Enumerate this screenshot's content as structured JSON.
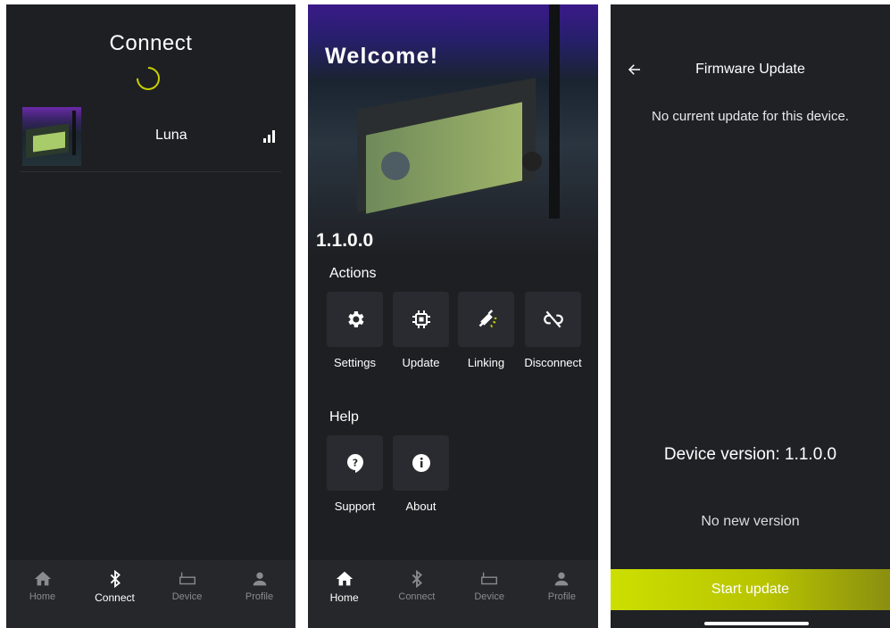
{
  "connect_screen": {
    "title": "Connect",
    "device": {
      "name": "Luna",
      "signal_icon": "signal-bars-icon"
    },
    "tabs": [
      {
        "label": "Home",
        "icon": "home-icon",
        "active": false
      },
      {
        "label": "Connect",
        "icon": "bluetooth-icon",
        "active": true
      },
      {
        "label": "Device",
        "icon": "device-icon",
        "active": false
      },
      {
        "label": "Profile",
        "icon": "profile-icon",
        "active": false
      }
    ]
  },
  "home_screen": {
    "welcome": "Welcome!",
    "version": "1.1.0.0",
    "actions_heading": "Actions",
    "actions": [
      {
        "label": "Settings",
        "icon": "gear-icon"
      },
      {
        "label": "Update",
        "icon": "chip-icon"
      },
      {
        "label": "Linking",
        "icon": "plug-link-icon"
      },
      {
        "label": "Disconnect",
        "icon": "unlink-icon"
      }
    ],
    "help_heading": "Help",
    "help": [
      {
        "label": "Support",
        "icon": "help-bubble-icon"
      },
      {
        "label": "About",
        "icon": "info-icon"
      }
    ],
    "tabs": [
      {
        "label": "Home",
        "icon": "home-icon",
        "active": true
      },
      {
        "label": "Connect",
        "icon": "bluetooth-icon",
        "active": false
      },
      {
        "label": "Device",
        "icon": "device-icon",
        "active": false
      },
      {
        "label": "Profile",
        "icon": "profile-icon",
        "active": false
      }
    ]
  },
  "firmware_screen": {
    "title": "Firmware Update",
    "no_update_text": "No current update for this device.",
    "device_version": "Device version: 1.1.0.0",
    "no_new_version": "No new version",
    "start_button": "Start update"
  },
  "colors": {
    "background": "#1e1f23",
    "accent": "#c8d000",
    "tile": "#2a2b30"
  }
}
